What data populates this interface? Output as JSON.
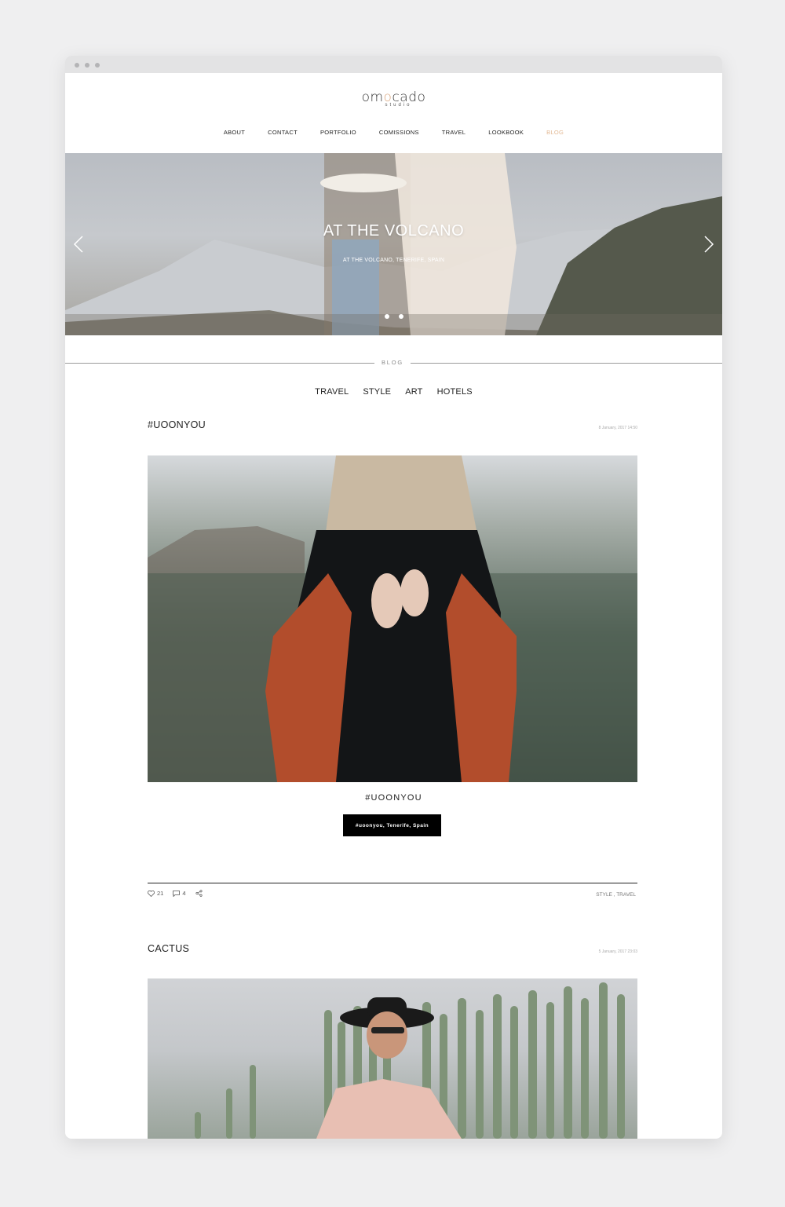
{
  "brand": {
    "logo_prefix": "om",
    "logo_accent": "o",
    "logo_suffix": "cado",
    "logo_sub": "studio",
    "accent_color": "#d9a47b"
  },
  "nav": {
    "items": [
      "ABOUT",
      "CONTACT",
      "PORTFOLIO",
      "COMISSIONS",
      "TRAVEL",
      "LOOKBOOK",
      "BLOG"
    ],
    "active": "BLOG",
    "active_color": "#e3b994"
  },
  "hero": {
    "title": "AT THE VOLCANO",
    "subtitle": "AT THE VOLCANO, TENERIFE, SPAIN",
    "slide_count": 2,
    "left_arrow_icon": "chevron-left-icon",
    "right_arrow_icon": "chevron-right-icon"
  },
  "section": {
    "label": "BLOG"
  },
  "categories": [
    "TRAVEL",
    "STYLE",
    "ART",
    "HOTELS"
  ],
  "posts": [
    {
      "title": "#UOONYOU",
      "date": "8 January, 2017 14:50",
      "caption": "#UOONYOU",
      "tag_button": "#uoonyou, Tenerife, Spain",
      "likes": "21",
      "comments": "4",
      "categories": "STYLE , TRAVEL"
    },
    {
      "title": "CACTUS",
      "date": "5 January, 2017 23:03"
    }
  ],
  "icons": {
    "like": "heart-icon",
    "comment": "comment-icon",
    "share": "share-icon"
  }
}
